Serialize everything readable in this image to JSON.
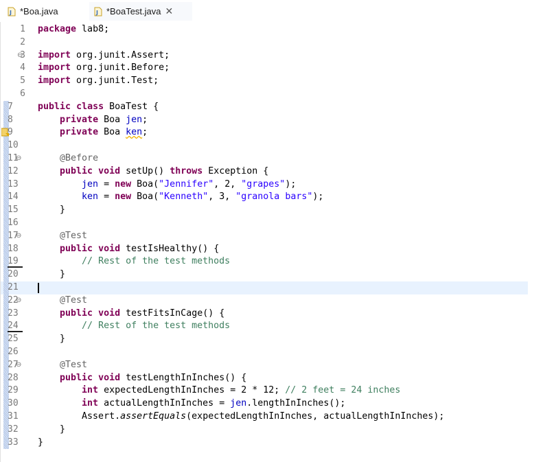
{
  "tabs": [
    {
      "label": "*Boa.java",
      "active": false
    },
    {
      "label": "*BoaTest.java",
      "active": true,
      "close_glyph": "✕"
    }
  ],
  "icons": {
    "tab_file": "java-file-icon",
    "close": "close-icon",
    "fold": "collapse-icon",
    "warning": "warning-marker-icon"
  },
  "colors": {
    "keyword": "#7f0055",
    "string": "#2a00ff",
    "comment": "#3f7f5f",
    "annotation": "#646464",
    "field": "#0000c0",
    "current_line_bg": "#e8f2fe"
  },
  "editor": {
    "current_line": 21,
    "lines": [
      {
        "n": "1",
        "fold": "",
        "changed": false,
        "tokens": [
          {
            "t": "package",
            "c": "kw"
          },
          {
            "t": " lab8;",
            "c": "plain"
          }
        ]
      },
      {
        "n": "2",
        "fold": "",
        "changed": false,
        "tokens": []
      },
      {
        "n": "3",
        "fold": "⊖",
        "changed": false,
        "tokens": [
          {
            "t": "import",
            "c": "kw"
          },
          {
            "t": " org.junit.Assert;",
            "c": "plain"
          }
        ]
      },
      {
        "n": "4",
        "fold": "",
        "changed": false,
        "tokens": [
          {
            "t": "import",
            "c": "kw"
          },
          {
            "t": " org.junit.Before;",
            "c": "plain"
          }
        ]
      },
      {
        "n": "5",
        "fold": "",
        "changed": false,
        "tokens": [
          {
            "t": "import",
            "c": "kw"
          },
          {
            "t": " org.junit.Test;",
            "c": "plain"
          }
        ]
      },
      {
        "n": "6",
        "fold": "",
        "changed": false,
        "tokens": []
      },
      {
        "n": "7",
        "fold": "",
        "changed": true,
        "tokens": [
          {
            "t": "public",
            "c": "kw"
          },
          {
            "t": " ",
            "c": "plain"
          },
          {
            "t": "class",
            "c": "kw"
          },
          {
            "t": " BoaTest {",
            "c": "plain"
          }
        ]
      },
      {
        "n": "8",
        "fold": "",
        "changed": true,
        "tokens": [
          {
            "t": "    ",
            "c": "plain"
          },
          {
            "t": "private",
            "c": "kw"
          },
          {
            "t": " Boa ",
            "c": "plain"
          },
          {
            "t": "jen",
            "c": "fld"
          },
          {
            "t": ";",
            "c": "plain"
          }
        ]
      },
      {
        "n": "9",
        "fold": "",
        "changed": true,
        "tokens": [
          {
            "t": "    ",
            "c": "plain"
          },
          {
            "t": "private",
            "c": "kw"
          },
          {
            "t": " Boa ",
            "c": "plain"
          },
          {
            "t": "ken",
            "c": "fld warn-underline"
          },
          {
            "t": ";",
            "c": "plain"
          }
        ]
      },
      {
        "n": "10",
        "fold": "",
        "changed": true,
        "tokens": []
      },
      {
        "n": "11",
        "fold": "⊖",
        "changed": true,
        "tokens": [
          {
            "t": "    ",
            "c": "plain"
          },
          {
            "t": "@Before",
            "c": "ann"
          }
        ]
      },
      {
        "n": "12",
        "fold": "",
        "changed": true,
        "tokens": [
          {
            "t": "    ",
            "c": "plain"
          },
          {
            "t": "public",
            "c": "kw"
          },
          {
            "t": " ",
            "c": "plain"
          },
          {
            "t": "void",
            "c": "kw"
          },
          {
            "t": " setUp() ",
            "c": "plain"
          },
          {
            "t": "throws",
            "c": "kw"
          },
          {
            "t": " Exception {",
            "c": "plain"
          }
        ]
      },
      {
        "n": "13",
        "fold": "",
        "changed": true,
        "tokens": [
          {
            "t": "        ",
            "c": "plain"
          },
          {
            "t": "jen",
            "c": "fld"
          },
          {
            "t": " = ",
            "c": "plain"
          },
          {
            "t": "new",
            "c": "kw"
          },
          {
            "t": " Boa(",
            "c": "plain"
          },
          {
            "t": "\"Jennifer\"",
            "c": "str"
          },
          {
            "t": ", 2, ",
            "c": "plain"
          },
          {
            "t": "\"grapes\"",
            "c": "str"
          },
          {
            "t": ");",
            "c": "plain"
          }
        ]
      },
      {
        "n": "14",
        "fold": "",
        "changed": true,
        "tokens": [
          {
            "t": "        ",
            "c": "plain"
          },
          {
            "t": "ken",
            "c": "fld"
          },
          {
            "t": " = ",
            "c": "plain"
          },
          {
            "t": "new",
            "c": "kw"
          },
          {
            "t": " Boa(",
            "c": "plain"
          },
          {
            "t": "\"Kenneth\"",
            "c": "str"
          },
          {
            "t": ", 3, ",
            "c": "plain"
          },
          {
            "t": "\"granola bars\"",
            "c": "str"
          },
          {
            "t": ");",
            "c": "plain"
          }
        ]
      },
      {
        "n": "15",
        "fold": "",
        "changed": true,
        "tokens": [
          {
            "t": "    }",
            "c": "plain"
          }
        ]
      },
      {
        "n": "16",
        "fold": "",
        "changed": true,
        "tokens": []
      },
      {
        "n": "17",
        "fold": "⊖",
        "changed": true,
        "tokens": [
          {
            "t": "    ",
            "c": "plain"
          },
          {
            "t": "@Test",
            "c": "ann"
          }
        ]
      },
      {
        "n": "18",
        "fold": "",
        "changed": true,
        "tokens": [
          {
            "t": "    ",
            "c": "plain"
          },
          {
            "t": "public",
            "c": "kw"
          },
          {
            "t": " ",
            "c": "plain"
          },
          {
            "t": "void",
            "c": "kw"
          },
          {
            "t": " testIsHealthy() {",
            "c": "plain"
          }
        ]
      },
      {
        "n": "19",
        "fold": "",
        "changed": true,
        "underline": true,
        "tokens": [
          {
            "t": "        ",
            "c": "plain"
          },
          {
            "t": "// Rest of the test methods",
            "c": "com"
          }
        ]
      },
      {
        "n": "20",
        "fold": "",
        "changed": true,
        "tokens": [
          {
            "t": "    }",
            "c": "plain"
          }
        ]
      },
      {
        "n": "21",
        "fold": "",
        "changed": true,
        "tokens": []
      },
      {
        "n": "22",
        "fold": "⊖",
        "changed": true,
        "tokens": [
          {
            "t": "    ",
            "c": "plain"
          },
          {
            "t": "@Test",
            "c": "ann"
          }
        ]
      },
      {
        "n": "23",
        "fold": "",
        "changed": true,
        "tokens": [
          {
            "t": "    ",
            "c": "plain"
          },
          {
            "t": "public",
            "c": "kw"
          },
          {
            "t": " ",
            "c": "plain"
          },
          {
            "t": "void",
            "c": "kw"
          },
          {
            "t": " testFitsInCage() {",
            "c": "plain"
          }
        ]
      },
      {
        "n": "24",
        "fold": "",
        "changed": true,
        "underline": true,
        "tokens": [
          {
            "t": "        ",
            "c": "plain"
          },
          {
            "t": "// Rest of the test methods",
            "c": "com"
          }
        ]
      },
      {
        "n": "25",
        "fold": "",
        "changed": true,
        "tokens": [
          {
            "t": "    }",
            "c": "plain"
          }
        ]
      },
      {
        "n": "26",
        "fold": "",
        "changed": true,
        "tokens": []
      },
      {
        "n": "27",
        "fold": "⊖",
        "changed": true,
        "tokens": [
          {
            "t": "    ",
            "c": "plain"
          },
          {
            "t": "@Test",
            "c": "ann"
          }
        ]
      },
      {
        "n": "28",
        "fold": "",
        "changed": true,
        "tokens": [
          {
            "t": "    ",
            "c": "plain"
          },
          {
            "t": "public",
            "c": "kw"
          },
          {
            "t": " ",
            "c": "plain"
          },
          {
            "t": "void",
            "c": "kw"
          },
          {
            "t": " testLengthInInches() {",
            "c": "plain"
          }
        ]
      },
      {
        "n": "29",
        "fold": "",
        "changed": true,
        "tokens": [
          {
            "t": "        ",
            "c": "plain"
          },
          {
            "t": "int",
            "c": "kw"
          },
          {
            "t": " expectedLengthInInches = 2 * 12; ",
            "c": "plain"
          },
          {
            "t": "// 2 feet = 24 inches",
            "c": "com"
          }
        ]
      },
      {
        "n": "30",
        "fold": "",
        "changed": true,
        "tokens": [
          {
            "t": "        ",
            "c": "plain"
          },
          {
            "t": "int",
            "c": "kw"
          },
          {
            "t": " actualLengthInInches = ",
            "c": "plain"
          },
          {
            "t": "jen",
            "c": "fld"
          },
          {
            "t": ".lengthInInches();",
            "c": "plain"
          }
        ]
      },
      {
        "n": "31",
        "fold": "",
        "changed": true,
        "tokens": [
          {
            "t": "        Assert.",
            "c": "plain"
          },
          {
            "t": "assertEquals",
            "c": "ital plain"
          },
          {
            "t": "(expectedLengthInInches, actualLengthInInches);",
            "c": "plain"
          }
        ]
      },
      {
        "n": "32",
        "fold": "",
        "changed": true,
        "tokens": [
          {
            "t": "    }",
            "c": "plain"
          }
        ]
      },
      {
        "n": "33",
        "fold": "",
        "changed": true,
        "tokens": [
          {
            "t": "}",
            "c": "plain"
          }
        ]
      }
    ]
  }
}
